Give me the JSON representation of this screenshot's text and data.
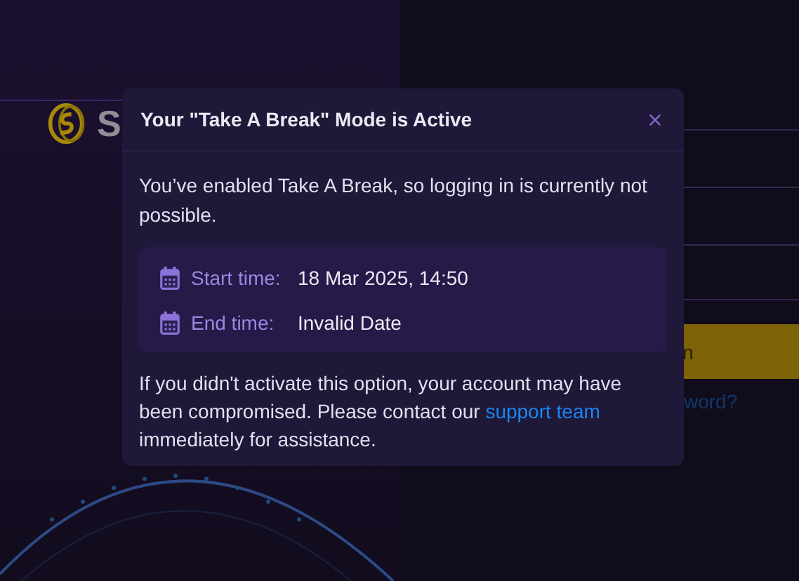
{
  "background": {
    "logo_text": "S",
    "button_label": "n",
    "link_text": "word?"
  },
  "dialog": {
    "title": "Your \"Take A Break\" Mode is Active",
    "message": "You’ve enabled Take A Break, so logging in is currently not possible.",
    "times": [
      {
        "label": "Start time:",
        "value": "18 Mar 2025, 14:50"
      },
      {
        "label": "End time:",
        "value": "Invalid Date"
      }
    ],
    "note_before": "If you didn't activate this option, your account may have been compromised. Please contact our ",
    "link": "support team",
    "note_after": " immediately for assistance."
  }
}
